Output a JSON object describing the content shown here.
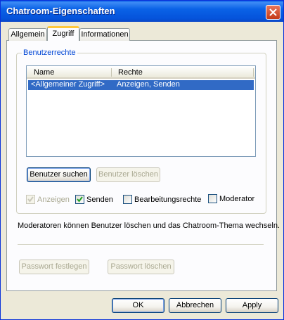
{
  "window": {
    "title": "Chatroom-Eigenschaften"
  },
  "tabs": [
    {
      "label": "Allgemein"
    },
    {
      "label": "Zugriff"
    },
    {
      "label": "Informationen"
    }
  ],
  "group": {
    "label": "Benutzerrechte",
    "columns": [
      "Name",
      "Rechte"
    ],
    "rows": [
      {
        "name": "<Allgemeiner Zugriff>",
        "rights": "Anzeigen, Senden",
        "selected": true
      }
    ],
    "search_button": "Benutzer suchen",
    "delete_button": "Benutzer löschen",
    "checkboxes": [
      {
        "label": "Anzeigen",
        "checked": true,
        "disabled": true
      },
      {
        "label": "Senden",
        "checked": true,
        "disabled": false
      },
      {
        "label": "Bearbeitungsrechte",
        "checked": false,
        "disabled": false
      },
      {
        "label": "Moderator",
        "checked": false,
        "disabled": false
      }
    ]
  },
  "info_text": "Moderatoren können Benutzer löschen und das Chatroom-Thema wechseln.",
  "password": {
    "set_button": "Passwort festlegen",
    "delete_button": "Passwort löschen"
  },
  "footer": {
    "ok": "OK",
    "cancel": "Abbrechen",
    "apply": "Apply"
  },
  "colors": {
    "titlebar": "#0a5ee8",
    "selection": "#316ac5",
    "group_label": "#0046d5",
    "tab_highlight": "#ffc83c"
  }
}
